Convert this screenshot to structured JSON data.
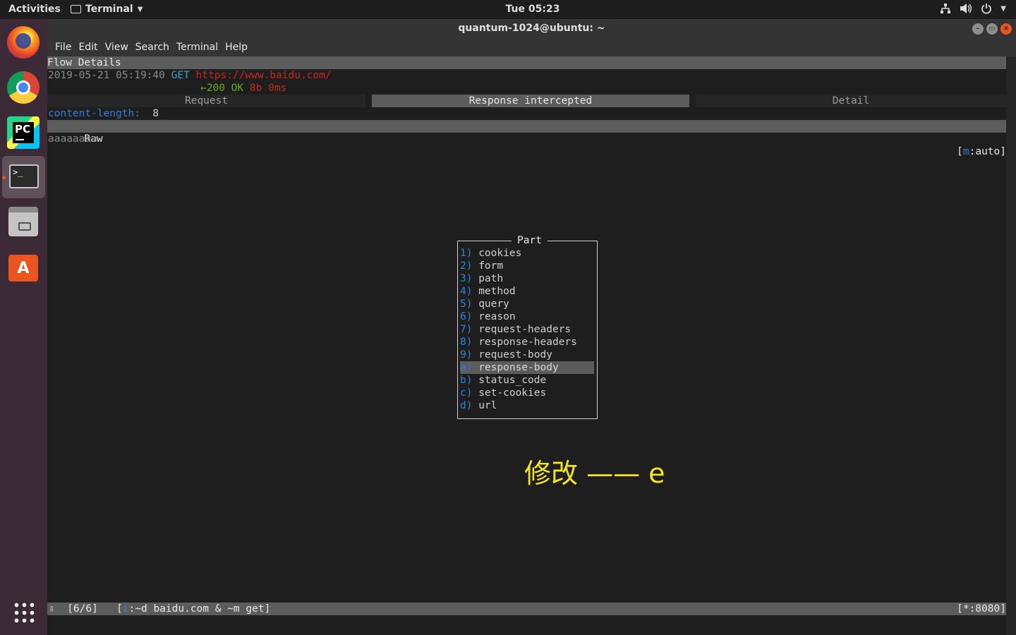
{
  "topbar": {
    "activities": "Activities",
    "app_menu": "Terminal",
    "clock": "Tue 05:23"
  },
  "dock": {
    "items": [
      "firefox",
      "chrome",
      "pycharm",
      "terminal",
      "files",
      "software"
    ],
    "pycharm_label": "PC",
    "terminal_prompt": ">_",
    "software_label": "A"
  },
  "window": {
    "title": "quantum-1024@ubuntu: ~",
    "menu": [
      "File",
      "Edit",
      "View",
      "Search",
      "Terminal",
      "Help"
    ]
  },
  "flow": {
    "header": "Flow Details",
    "timestamp": "2019-05-21 05:19:40",
    "method": "GET",
    "url": "https://www.baidu.com/",
    "arrow": "←",
    "status": "200 OK",
    "size": "8b",
    "time": "0ms",
    "tabs": [
      "Request",
      "Response intercepted",
      "Detail"
    ],
    "header_key": "content-length:",
    "header_value": "8",
    "raw_label": "Raw",
    "mode_prefix": "[",
    "mode_key": "m",
    "mode_suffix": ":auto]",
    "body": "aaaaaaaa"
  },
  "part_menu": {
    "title": "Part",
    "selected_index": 9,
    "options": [
      {
        "key": "1)",
        "label": "cookies"
      },
      {
        "key": "2)",
        "label": "form"
      },
      {
        "key": "3)",
        "label": "path"
      },
      {
        "key": "4)",
        "label": "method"
      },
      {
        "key": "5)",
        "label": "query"
      },
      {
        "key": "6)",
        "label": "reason"
      },
      {
        "key": "7)",
        "label": "request-headers"
      },
      {
        "key": "8)",
        "label": "response-headers"
      },
      {
        "key": "9)",
        "label": "request-body"
      },
      {
        "key": "a)",
        "label": "response-body"
      },
      {
        "key": "b)",
        "label": "status_code"
      },
      {
        "key": "c)",
        "label": "set-cookies"
      },
      {
        "key": "d)",
        "label": "url"
      }
    ]
  },
  "annotation": "修改 —— e",
  "status": {
    "arrow": "⇩",
    "count": "[6/6]",
    "filter_open": "[",
    "filter_key": "i",
    "filter_rest": ":~d baidu.com & ~m get]",
    "listen": "[*:8080]"
  },
  "colors": {
    "accent": "#e95420",
    "key_blue": "#2f80d9",
    "url_red": "#c4261d",
    "status_green": "#6aa519",
    "annotation_yellow": "#f5e61a"
  }
}
